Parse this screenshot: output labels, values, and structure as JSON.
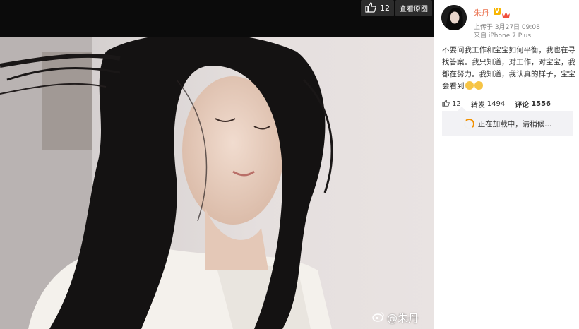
{
  "viewer": {
    "like_count": "12",
    "view_original_label": "查看原图",
    "watermark_text": "@朱丹"
  },
  "post": {
    "username": "朱丹",
    "verified_badge": "V",
    "posted_at": "上传于 3月27日 09:08",
    "device": "来自 iPhone 7 Plus",
    "text": "不要问我工作和宝宝如何平衡，我也在寻找答案。我只知道，对工作，对宝宝，我都在努力。我知道，我认真的样子，宝宝会看到",
    "emoji_count": 2
  },
  "stats": {
    "likes": "12",
    "repost_label": "转发",
    "repost_count": "1494",
    "comment_label": "评论",
    "comment_count": "1556"
  },
  "comments": {
    "loading_text": "正在加载中，请稍候..."
  },
  "colors": {
    "username": "#eb7350",
    "spinner": "#f29100",
    "loading_bg": "#f2f2f5"
  }
}
